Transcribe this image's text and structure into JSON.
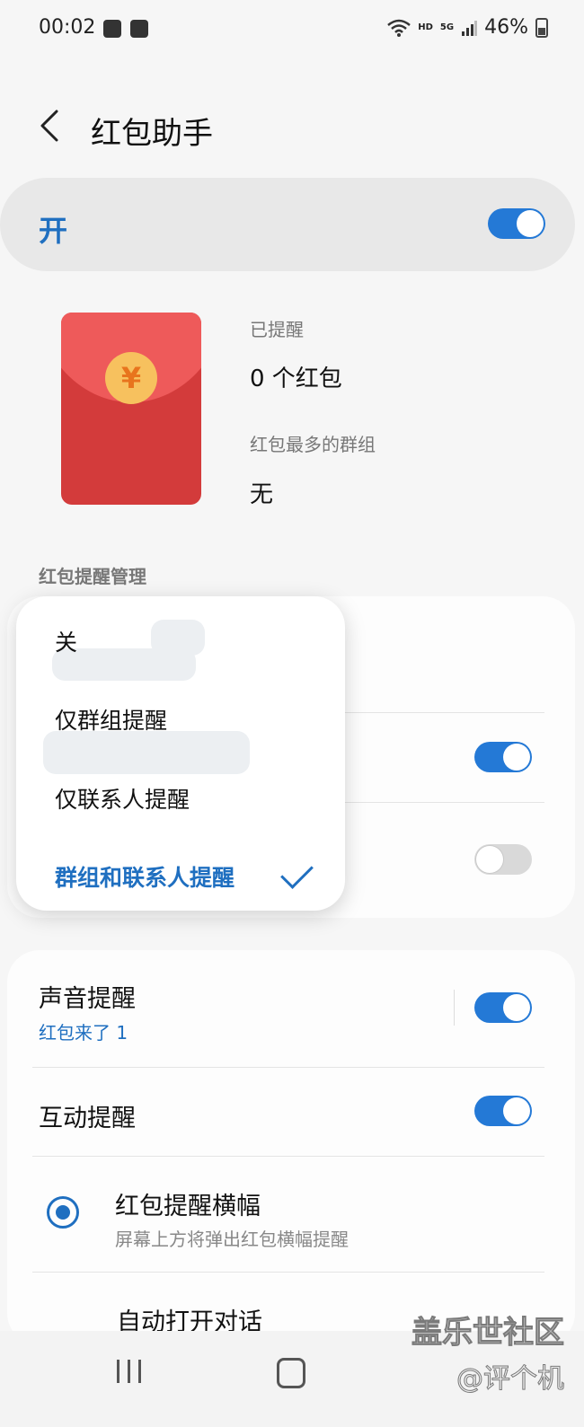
{
  "status_bar": {
    "time": "00:02",
    "battery": "46%",
    "network": "5G",
    "hd": "HD"
  },
  "header": {
    "title": "红包助手"
  },
  "master_switch": {
    "label": "开",
    "state": "on"
  },
  "stats": {
    "reminded_label": "已提醒",
    "reminded_value": "0 个红包",
    "top_group_label": "红包最多的群组",
    "top_group_value": "无",
    "coin_symbol": "¥"
  },
  "section": {
    "title": "红包提醒管理"
  },
  "dropdown": {
    "options": [
      "关",
      "仅群组提醒",
      "仅联系人提醒",
      "群组和联系人提醒"
    ],
    "selected": "群组和联系人提醒"
  },
  "hidden_toggles": {
    "row1": "on",
    "row2": "off"
  },
  "settings": {
    "sound": {
      "title": "声音提醒",
      "value": "红包来了 1",
      "state": "on"
    },
    "interaction": {
      "title": "互动提醒",
      "state": "on"
    },
    "banner": {
      "title": "红包提醒横幅",
      "desc": "屏幕上方将弹出红包横幅提醒",
      "selected": true
    },
    "auto_open": {
      "title": "自动打开对话"
    }
  },
  "watermark": {
    "line1": "盖乐世社区",
    "line2": "@评个机"
  },
  "colors": {
    "accent": "#1f6fc0",
    "toggle_on": "#2479d6",
    "envelope": "#d33b3b",
    "coin": "#f7c15e"
  }
}
